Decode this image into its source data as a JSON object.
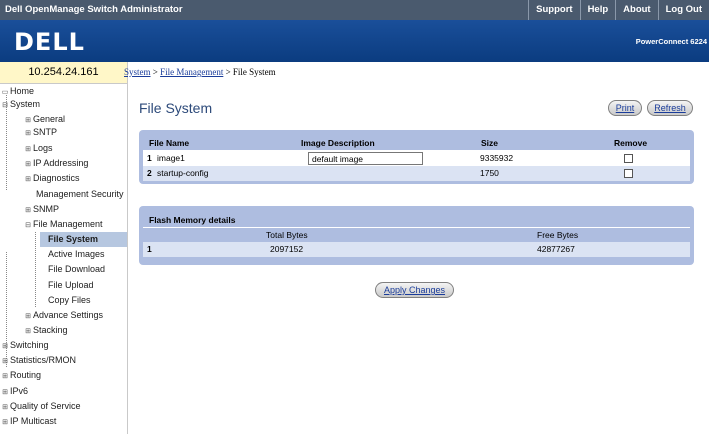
{
  "topbar": {
    "title": "Dell OpenManage Switch Administrator",
    "links": [
      "Support",
      "Help",
      "About",
      "Log Out"
    ]
  },
  "banner": {
    "logo": "DELL",
    "model": "PowerConnect 6224"
  },
  "ip": "10.254.24.161",
  "breadcrumb": {
    "items": [
      "System",
      "File Management"
    ],
    "sep": ">",
    "current": "File System"
  },
  "nav": [
    {
      "label": "Home",
      "icon": "home"
    },
    {
      "label": "System",
      "icon": "minus"
    },
    {
      "label": "General",
      "icon": "plus"
    },
    {
      "label": "SNTP",
      "icon": "plus"
    },
    {
      "label": "Logs",
      "icon": "plus"
    },
    {
      "label": "IP Addressing",
      "icon": "plus"
    },
    {
      "label": "Diagnostics",
      "icon": "plus"
    },
    {
      "label": "Management Security",
      "icon": "none"
    },
    {
      "label": "SNMP",
      "icon": "plus"
    },
    {
      "label": "File Management",
      "icon": "minus"
    },
    {
      "label": "File System",
      "icon": "none"
    },
    {
      "label": "Active Images",
      "icon": "none"
    },
    {
      "label": "File Download",
      "icon": "none"
    },
    {
      "label": "File Upload",
      "icon": "none"
    },
    {
      "label": "Copy Files",
      "icon": "none"
    },
    {
      "label": "Advance Settings",
      "icon": "plus"
    },
    {
      "label": "Stacking",
      "icon": "plus"
    },
    {
      "label": "Switching",
      "icon": "plus"
    },
    {
      "label": "Statistics/RMON",
      "icon": "plus"
    },
    {
      "label": "Routing",
      "icon": "plus"
    },
    {
      "label": "IPv6",
      "icon": "plus"
    },
    {
      "label": "Quality of Service",
      "icon": "plus"
    },
    {
      "label": "IP Multicast",
      "icon": "plus"
    }
  ],
  "page": {
    "title": "File System",
    "print_label": "Print",
    "refresh_label": "Refresh",
    "apply_label": "Apply Changes"
  },
  "files": {
    "headers": [
      "File Name",
      "Image Description",
      "Size",
      "Remove"
    ],
    "rows": [
      {
        "num": "1",
        "name": "image1",
        "description": "default image",
        "size": "9335932"
      },
      {
        "num": "2",
        "name": "startup-config",
        "description": "",
        "size": "1750"
      }
    ]
  },
  "flash": {
    "title": "Flash Memory details",
    "headers": [
      "Total Bytes",
      "Free Bytes"
    ],
    "row": {
      "num": "1",
      "total": "2097152",
      "free": "42877267"
    }
  }
}
